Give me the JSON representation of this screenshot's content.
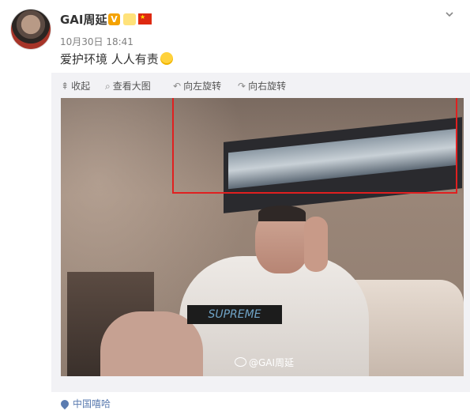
{
  "post": {
    "username": "GAI周延",
    "verified_badge": "V",
    "timestamp": "10月30日 18:41",
    "text": "爱护环境 人人有责"
  },
  "toolbar": {
    "collapse_label": "收起",
    "view_large_label": "查看大图",
    "rotate_left_label": "向左旋转",
    "rotate_right_label": "向右旋转"
  },
  "photo": {
    "shirt_text": "SUPREME",
    "watermark_text": "@GAI周延"
  },
  "location": {
    "label": "中国嘻哈"
  },
  "colors": {
    "highlight_box": "#e02020",
    "link": "#5a7bb0",
    "verified": "#f4a200"
  }
}
